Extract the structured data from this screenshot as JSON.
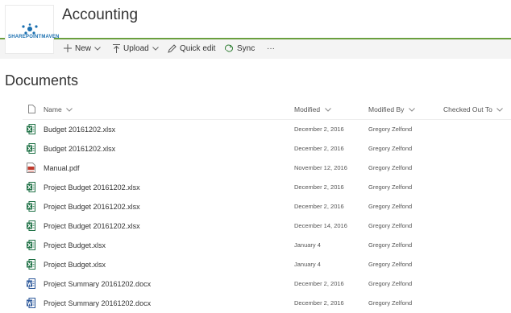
{
  "site": {
    "title": "Accounting",
    "logo_text": "SHAREPOINTMAVEN"
  },
  "commands": [
    {
      "label": "New",
      "icon": "plus-icon"
    },
    {
      "label": "Upload",
      "icon": "upload-arrow-icon"
    },
    {
      "label": "Quick edit",
      "icon": "pencil-icon"
    },
    {
      "label": "Sync",
      "icon": "sync-icon"
    },
    {
      "label": "···",
      "icon": "more-icon"
    }
  ],
  "library": {
    "title": "Documents",
    "columns": [
      "Name",
      "Modified",
      "Modified By",
      "Checked Out To"
    ],
    "rows": [
      {
        "name": "Budget 20161202.xlsx",
        "modified": "December 2, 2016",
        "modified_by": "Gregory Zelfond",
        "type": "excel"
      },
      {
        "name": "Budget 20161202.xlsx",
        "modified": "December 2, 2016",
        "modified_by": "Gregory Zelfond",
        "type": "excel"
      },
      {
        "name": "Manual.pdf",
        "modified": "November 12, 2016",
        "modified_by": "Gregory Zelfond",
        "type": "pdf"
      },
      {
        "name": "Project Budget 20161202.xlsx",
        "modified": "December 2, 2016",
        "modified_by": "Gregory Zelfond",
        "type": "excel"
      },
      {
        "name": "Project Budget 20161202.xlsx",
        "modified": "December 2, 2016",
        "modified_by": "Gregory Zelfond",
        "type": "excel"
      },
      {
        "name": "Project Budget 20161202.xlsx",
        "modified": "December 14, 2016",
        "modified_by": "Gregory Zelfond",
        "type": "excel"
      },
      {
        "name": "Project Budget.xlsx",
        "modified": "January 4",
        "modified_by": "Gregory Zelfond",
        "type": "excel"
      },
      {
        "name": "Project Budget.xlsx",
        "modified": "January 4",
        "modified_by": "Gregory Zelfond",
        "type": "excel"
      },
      {
        "name": "Project Summary 20161202.docx",
        "modified": "December 2, 2016",
        "modified_by": "Gregory Zelfond",
        "type": "word"
      },
      {
        "name": "Project Summary 20161202.docx",
        "modified": "December 2, 2016",
        "modified_by": "Gregory Zelfond",
        "type": "word"
      }
    ]
  },
  "colors": {
    "accent_green": "#6a9f3e",
    "excel": "#1e7145",
    "word": "#2b579a",
    "pdf": "#c0392b"
  }
}
